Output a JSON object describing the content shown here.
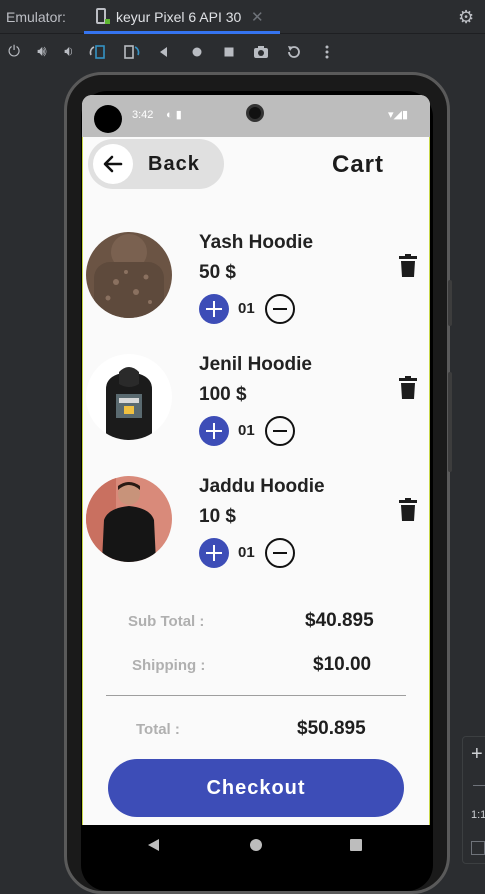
{
  "emulator": {
    "label": "Emulator:",
    "tab_label": "keyur Pixel 6 API 30",
    "tab_close": "✕",
    "gear": "⚙",
    "toolbar_icons": [
      "power-icon",
      "volume-up-icon",
      "volume-down-icon",
      "rotate-left-icon",
      "rotate-right-icon",
      "back-icon",
      "home-icon",
      "overview-icon",
      "camera-icon",
      "replay-icon",
      "more-icon"
    ]
  },
  "status_bar": {
    "time": "3:42",
    "left_icons": "◐ ▮",
    "right_icons": "▾◢▮"
  },
  "header": {
    "back_label": "Back",
    "title": "Cart"
  },
  "items": [
    {
      "name": "Yash Hoodie",
      "price": "50 $",
      "qty": "01",
      "image": "brown-knit-hoodie"
    },
    {
      "name": "Jenil Hoodie",
      "price": "100 $",
      "qty": "01",
      "image": "black-graphic-hoodie"
    },
    {
      "name": "Jaddu Hoodie",
      "price": "10 $",
      "qty": "01",
      "image": "black-hoodie-model"
    }
  ],
  "totals": {
    "subtotal_label": "Sub Total :",
    "subtotal_value": "$40.895",
    "shipping_label": "Shipping :",
    "shipping_value": "$10.00",
    "total_label": "Total :",
    "total_value": "$50.895"
  },
  "checkout_label": "Checkout",
  "side_panel": {
    "plus": "+",
    "ratio": "1:1"
  },
  "colors": {
    "accent": "#3d4db7",
    "status_bar": "#bdbdbd",
    "back_pill": "#e0e0e0"
  }
}
